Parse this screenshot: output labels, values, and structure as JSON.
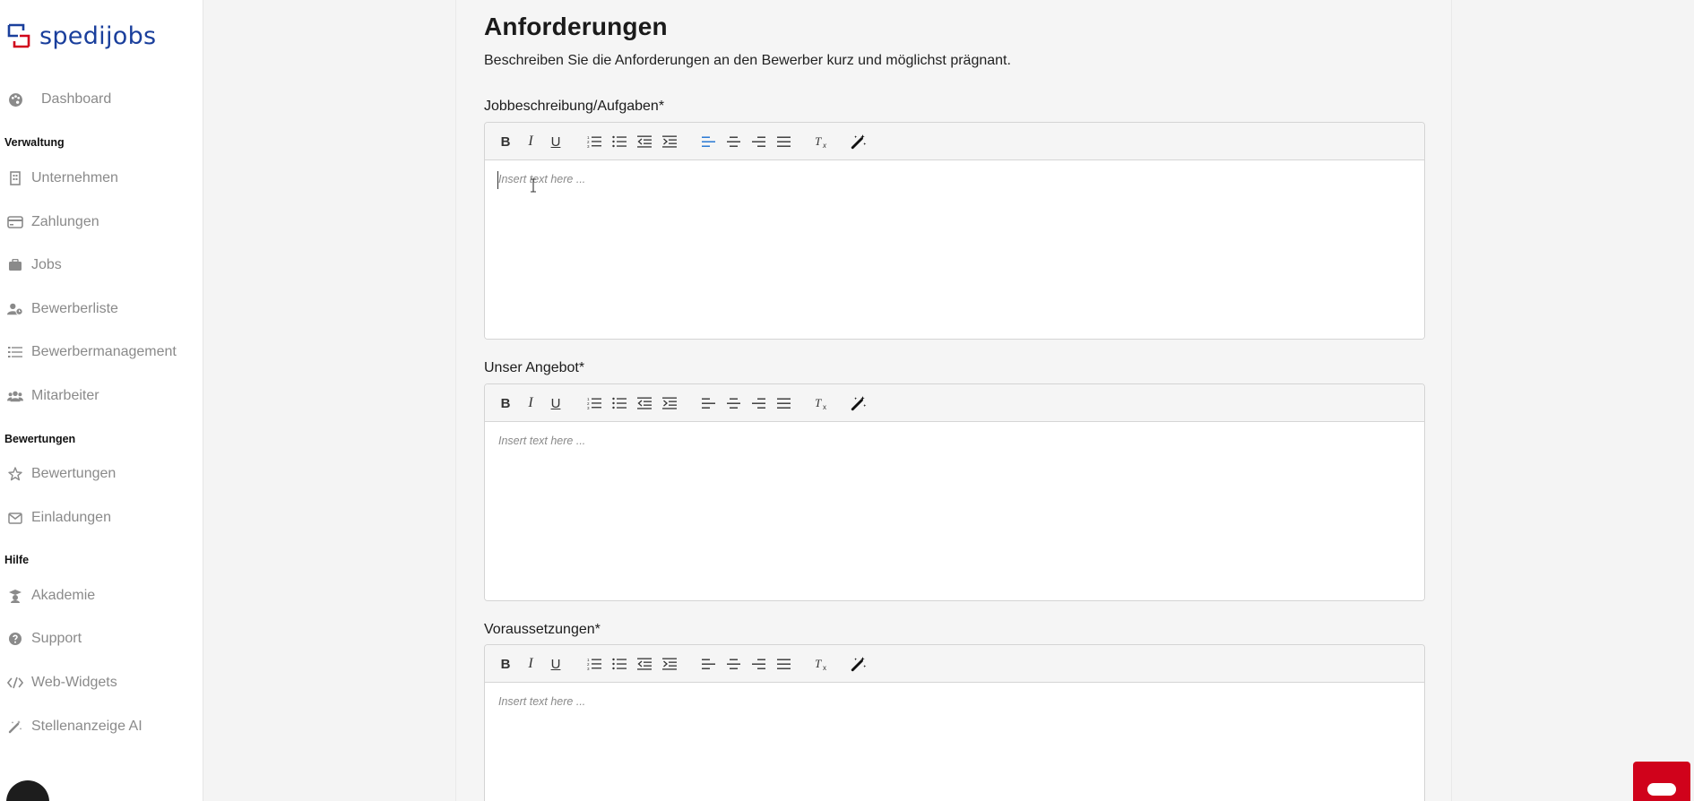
{
  "brand": {
    "name": "spedijobs",
    "primary": "#1a3f9c",
    "accent": "#d0021b"
  },
  "sidebar": {
    "dashboard": {
      "label": "Dashboard",
      "icon": "palette-icon"
    },
    "sections": [
      {
        "title": "Verwaltung",
        "items": [
          {
            "label": "Unternehmen",
            "icon": "building-icon"
          },
          {
            "label": "Zahlungen",
            "icon": "credit-card-icon"
          },
          {
            "label": "Jobs",
            "icon": "briefcase-icon"
          },
          {
            "label": "Bewerberliste",
            "icon": "user-clock-icon"
          },
          {
            "label": "Bewerbermanagement",
            "icon": "list-icon"
          },
          {
            "label": "Mitarbeiter",
            "icon": "users-icon"
          }
        ]
      },
      {
        "title": "Bewertungen",
        "items": [
          {
            "label": "Bewertungen",
            "icon": "star-icon"
          },
          {
            "label": "Einladungen",
            "icon": "envelope-icon"
          }
        ]
      },
      {
        "title": "Hilfe",
        "items": [
          {
            "label": "Akademie",
            "icon": "graduation-icon"
          },
          {
            "label": "Support",
            "icon": "question-icon"
          },
          {
            "label": "Web-Widgets",
            "icon": "code-icon"
          },
          {
            "label": "Stellenanzeige AI",
            "icon": "magic-wand-icon"
          }
        ]
      }
    ]
  },
  "main": {
    "title": "Anforderungen",
    "subtitle": "Beschreiben Sie die Anforderungen an den Bewerber kurz und möglichst prägnant.",
    "editors": [
      {
        "label": "Jobbeschreibung/Aufgaben*",
        "placeholder": "Insert text here ...",
        "focused": true
      },
      {
        "label": "Unser Angebot*",
        "placeholder": "Insert text here ...",
        "focused": false
      },
      {
        "label": "Voraussetzungen*",
        "placeholder": "Insert text here ...",
        "focused": false
      }
    ],
    "toolbar": {
      "bold": "B",
      "italic": "I",
      "underline": "U",
      "clear_format": "Tx",
      "active_color": "#1a6fd1"
    }
  }
}
